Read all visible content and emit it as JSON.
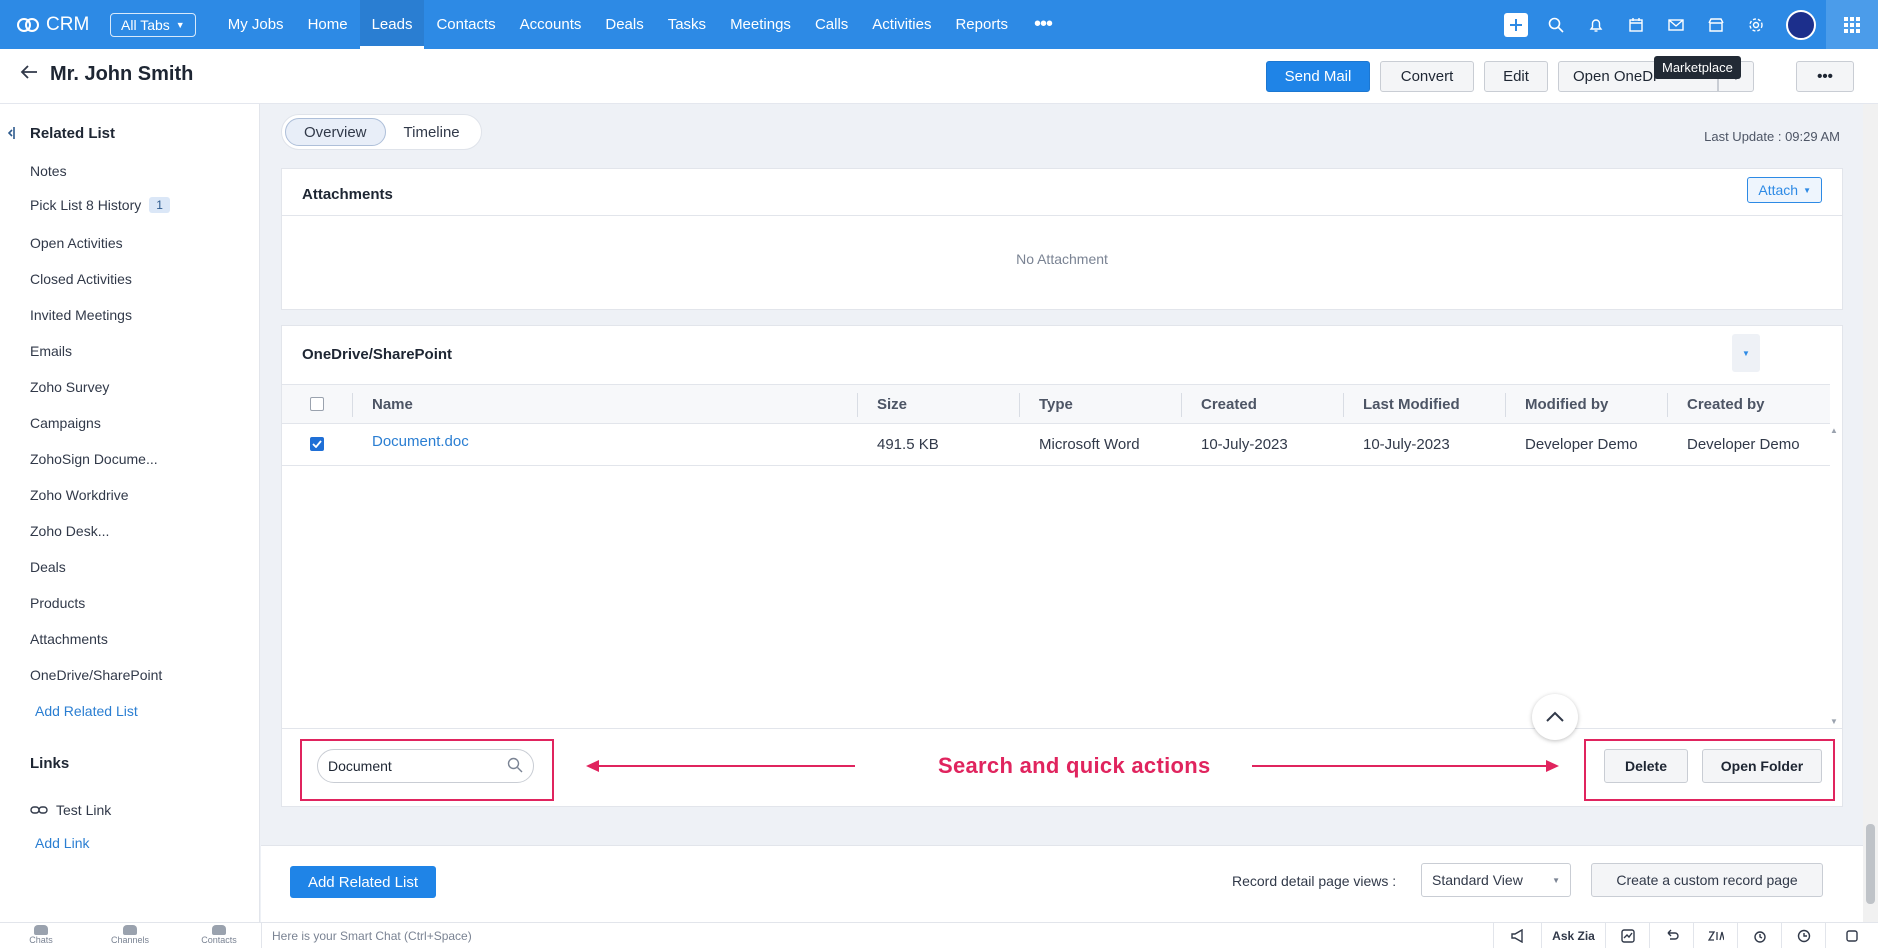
{
  "topbar": {
    "app_name": "CRM",
    "all_tabs": "All Tabs",
    "nav": [
      "My Jobs",
      "Home",
      "Leads",
      "Contacts",
      "Accounts",
      "Deals",
      "Tasks",
      "Meetings",
      "Calls",
      "Activities",
      "Reports"
    ],
    "active_nav": "Leads",
    "more": "•••"
  },
  "header": {
    "title": "Mr. John Smith",
    "send_mail": "Send Mail",
    "convert": "Convert",
    "edit": "Edit",
    "open_onedrive": "Open OneDr",
    "more": "•••",
    "tooltip": "Marketplace"
  },
  "sidebar": {
    "related_title": "Related List",
    "items": [
      {
        "label": "Notes"
      },
      {
        "label": "Pick List 8 History",
        "badge": "1"
      },
      {
        "label": "Open Activities"
      },
      {
        "label": "Closed Activities"
      },
      {
        "label": "Invited Meetings"
      },
      {
        "label": "Emails"
      },
      {
        "label": "Zoho Survey"
      },
      {
        "label": "Campaigns"
      },
      {
        "label": "ZohoSign Docume..."
      },
      {
        "label": "Zoho Workdrive"
      },
      {
        "label": "Zoho Desk..."
      },
      {
        "label": "Deals"
      },
      {
        "label": "Products"
      },
      {
        "label": "Attachments"
      },
      {
        "label": "OneDrive/SharePoint"
      }
    ],
    "add_related": "Add Related List",
    "links_title": "Links",
    "test_link": "Test Link",
    "add_link": "Add Link"
  },
  "main": {
    "tabs": [
      "Overview",
      "Timeline"
    ],
    "active_tab": "Overview",
    "last_update": "Last Update : 09:29 AM",
    "attachments": {
      "title": "Attachments",
      "attach_btn": "Attach",
      "empty": "No Attachment"
    },
    "onedrive": {
      "title": "OneDrive/SharePoint",
      "columns": [
        "Name",
        "Size",
        "Type",
        "Created",
        "Last Modified",
        "Modified by",
        "Created by"
      ],
      "rows": [
        {
          "name": "Document.doc",
          "size": "491.5 KB",
          "type": "Microsoft Word",
          "created": "10-July-2023",
          "modified": "10-July-2023",
          "modified_by": "Developer Demo",
          "created_by": "Developer Demo",
          "checked": true
        }
      ],
      "search_value": "Document",
      "annotation": "Search and quick actions",
      "delete": "Delete",
      "open_folder": "Open Folder"
    },
    "bottom": {
      "add_related": "Add Related List",
      "views_label": "Record detail page views :",
      "view_value": "Standard View",
      "custom_page": "Create a custom record page"
    }
  },
  "statusbar": {
    "chats": "Chats",
    "channels": "Channels",
    "contacts": "Contacts",
    "smart_chat": "Here is your Smart Chat (Ctrl+Space)",
    "ask_zia": "Ask Zia"
  },
  "colors": {
    "brand": "#2d8ae5",
    "annotation": "#e0245e",
    "link": "#2a7ed2"
  }
}
